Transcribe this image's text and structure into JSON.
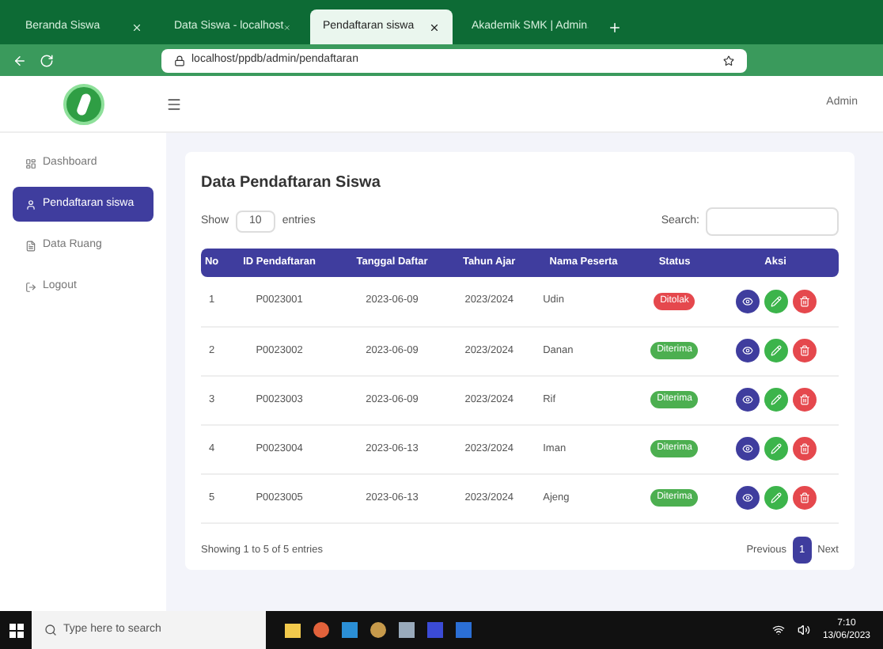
{
  "browser": {
    "tabs": [
      {
        "label": "Beranda Siswa",
        "selected": false
      },
      {
        "label": "Data Siswa - localhost",
        "selected": false
      },
      {
        "label": "Pendaftaran siswa",
        "selected": true
      },
      {
        "label": "Akademik SMK | Admin",
        "selected": false
      }
    ],
    "url": "localhost/ppdb/admin/pendaftaran"
  },
  "header": {
    "user": "Admin"
  },
  "sidebar": {
    "items": [
      {
        "label": "Dashboard",
        "selected": false
      },
      {
        "label": "Pendaftaran siswa",
        "selected": true
      },
      {
        "label": "Data Ruang",
        "selected": false
      },
      {
        "label": "Logout",
        "selected": false
      }
    ]
  },
  "page": {
    "title": "Data Pendaftaran Siswa",
    "show_label": "Show",
    "show_value": "10",
    "entries_label": "entries",
    "search_label": "Search:"
  },
  "table": {
    "columns": [
      "No",
      "ID Pendaftaran",
      "Tanggal Daftar",
      "Tahun Ajar",
      "Nama Peserta",
      "Status",
      "Aksi"
    ],
    "rows": [
      {
        "no": "1",
        "id": "P0023001",
        "date": "2023-06-09",
        "year": "2023/2024",
        "name": "Udin",
        "status": "Ditolak",
        "color": "#e5484d"
      },
      {
        "no": "2",
        "id": "P0023002",
        "date": "2023-06-09",
        "year": "2023/2024",
        "name": "Danan",
        "status": "Diterima",
        "color": "#4caf50"
      },
      {
        "no": "3",
        "id": "P0023003",
        "date": "2023-06-09",
        "year": "2023/2024",
        "name": "Rif",
        "status": "Diterima",
        "color": "#4caf50"
      },
      {
        "no": "4",
        "id": "P0023004",
        "date": "2023-06-13",
        "year": "2023/2024",
        "name": "Iman",
        "status": "Diterima",
        "color": "#4caf50"
      },
      {
        "no": "5",
        "id": "P0023005",
        "date": "2023-06-13",
        "year": "2023/2024",
        "name": "Ajeng",
        "status": "Diterima",
        "color": "#4caf50"
      }
    ]
  },
  "footer": {
    "info": "Showing 1 to 5 of 5 entries",
    "previous": "Previous",
    "pages": [
      {
        "label": "1",
        "selected": true
      }
    ],
    "next": "Next"
  },
  "taskbar": {
    "search_placeholder": "Type here to search",
    "time": "7:10",
    "date": "13/06/2023"
  }
}
